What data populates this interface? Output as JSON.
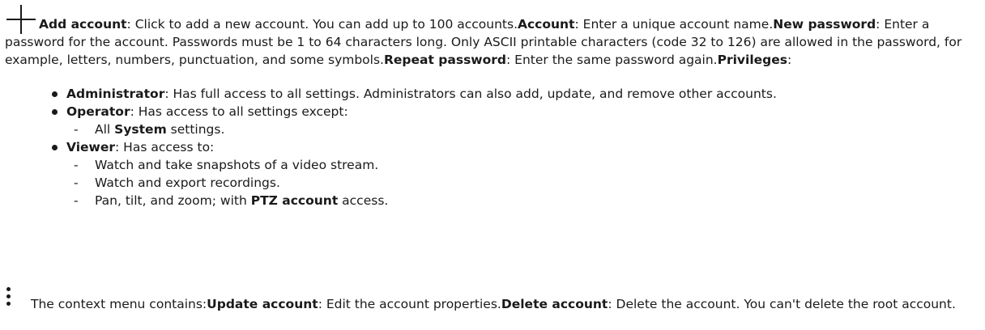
{
  "add_section": {
    "icon": "plus-icon",
    "add_account_label": "Add account",
    "add_account_desc": ": Click to add a new account. You can add up to 100 accounts.",
    "account_label": "Account",
    "account_desc": ": Enter a unique account name.",
    "new_password_label": "New password",
    "new_password_desc": ": Enter a password for the account. Passwords must be 1 to 64 characters long. Only ASCII printable characters (code 32 to 126) are allowed in the password, for example, letters, numbers, punctuation, and some symbols.",
    "repeat_password_label": "Repeat password",
    "repeat_password_desc": ": Enter the same password again.",
    "privileges_label": "Privileges",
    "privileges_colon": ":"
  },
  "privileges": {
    "administrator": {
      "label": "Administrator",
      "desc": ": Has full access to all settings. Administrators can also add, update, and remove other accounts."
    },
    "operator": {
      "label": "Operator",
      "desc": ": Has access to all settings except:",
      "sub_dash": "-",
      "sub_prefix": "All ",
      "sub_bold": "System",
      "sub_suffix": " settings."
    },
    "viewer": {
      "label": "Viewer",
      "desc": ": Has access to:",
      "sub_dash": "-",
      "sub1": "Watch and take snapshots of a video stream.",
      "sub2": "Watch and export recordings.",
      "sub3_prefix": "Pan, tilt, and zoom; with ",
      "sub3_bold": "PTZ account",
      "sub3_suffix": " access."
    }
  },
  "context_section": {
    "icon": "kebab-menu-icon",
    "intro": "The context menu contains:",
    "update_label": "Update account",
    "update_desc": ": Edit the account properties.",
    "delete_label": "Delete account",
    "delete_desc": ": Delete the account. You can't delete the root account."
  }
}
